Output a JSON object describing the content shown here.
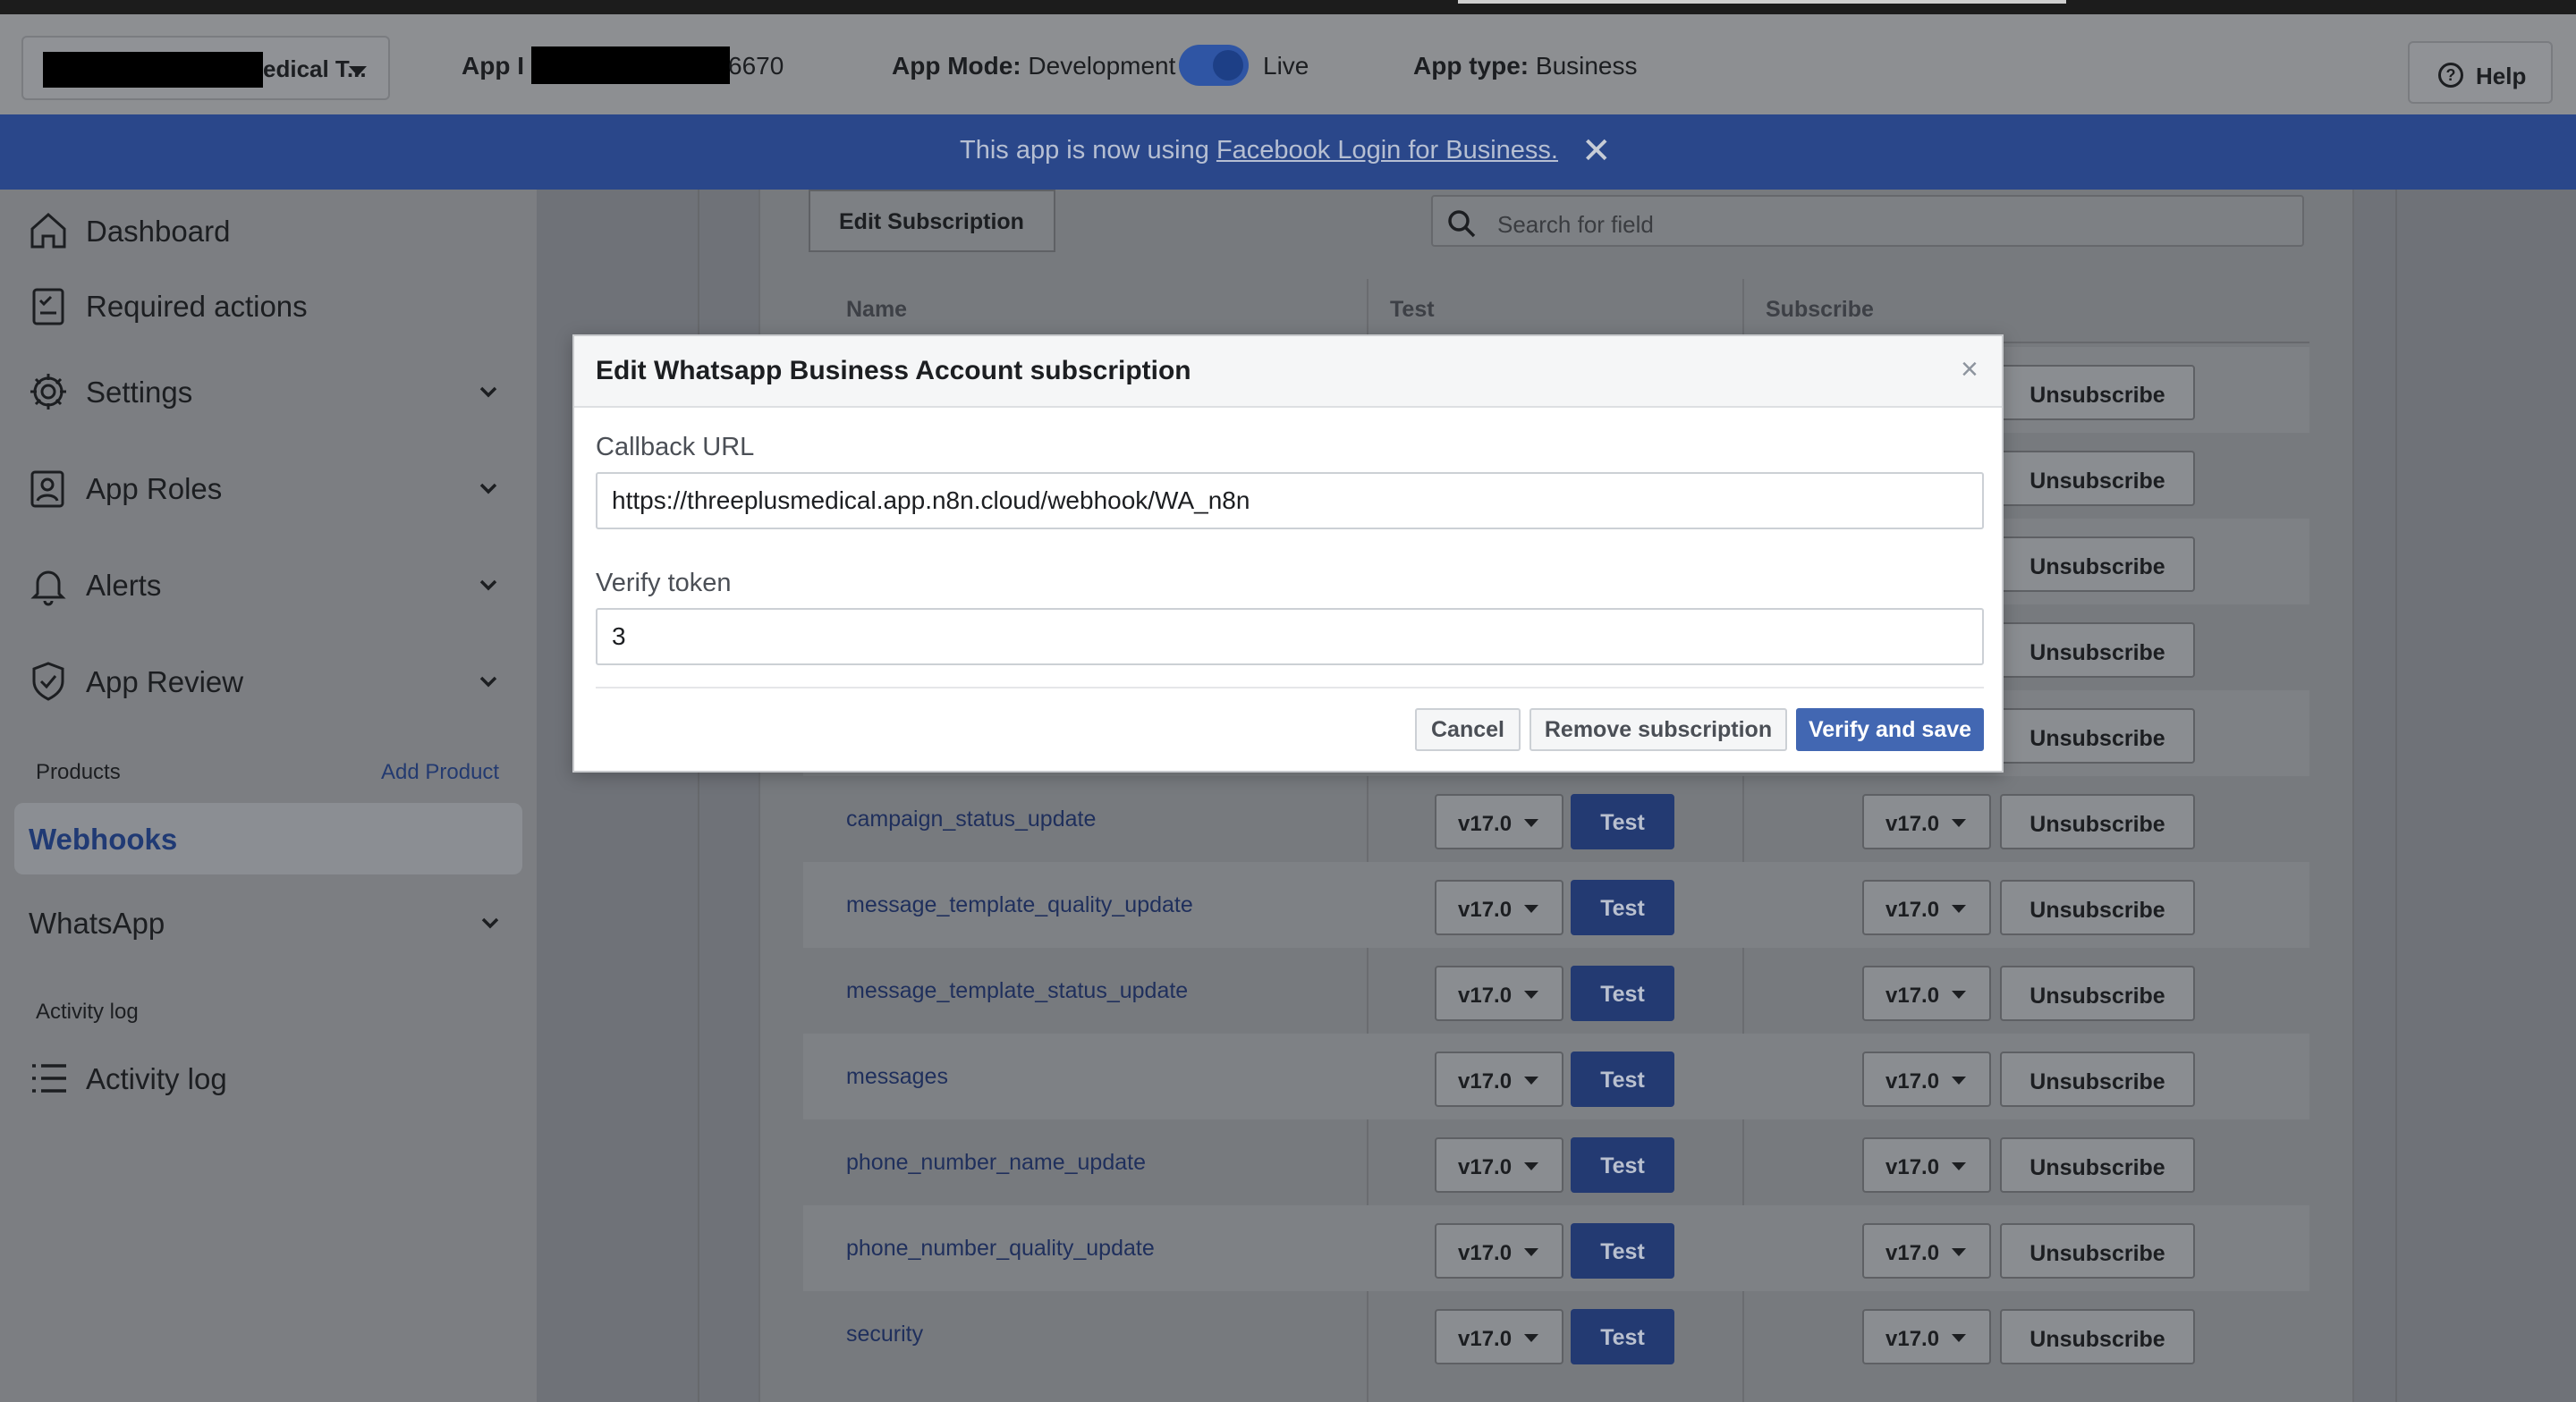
{
  "header": {
    "app_name_visible": "edical T...",
    "app_id_label": "App I",
    "app_id_tail": "6670",
    "app_mode_label": "App Mode:",
    "app_mode_value": "Development",
    "live_label": "Live",
    "app_type_label": "App type:",
    "app_type_value": "Business",
    "help_label": "Help"
  },
  "banner": {
    "text": "This app is now using ",
    "link": "Facebook Login for Business."
  },
  "sidebar": {
    "items": [
      {
        "label": "Dashboard",
        "icon": "home-icon"
      },
      {
        "label": "Required actions",
        "icon": "checklist-icon"
      },
      {
        "label": "Settings",
        "icon": "gear-icon"
      },
      {
        "label": "App Roles",
        "icon": "user-badge-icon"
      },
      {
        "label": "Alerts",
        "icon": "bell-icon"
      },
      {
        "label": "App Review",
        "icon": "shield-check-icon"
      }
    ],
    "products_label": "Products",
    "add_product_label": "Add Product",
    "webhooks_label": "Webhooks",
    "whatsapp_label": "WhatsApp",
    "activity_section_label": "Activity log",
    "activity_item_label": "Activity log"
  },
  "main": {
    "edit_subscription_label": "Edit Subscription",
    "search_placeholder": "Search for field",
    "columns": {
      "name": "Name",
      "test": "Test",
      "subscribe": "Subscribe"
    },
    "version": "v17.0",
    "test_label": "Test",
    "unsubscribe_label": "Unsubscribe",
    "rows": [
      "",
      "",
      "",
      "",
      "",
      "campaign_status_update",
      "message_template_quality_update",
      "message_template_status_update",
      "messages",
      "phone_number_name_update",
      "phone_number_quality_update",
      "security"
    ]
  },
  "modal": {
    "title": "Edit Whatsapp Business Account subscription",
    "close": "×",
    "callback_label": "Callback URL",
    "callback_value": "https://threeplusmedical.app.n8n.cloud/webhook/WA_n8n",
    "verify_label": "Verify token",
    "verify_value": "3",
    "cancel": "Cancel",
    "remove": "Remove subscription",
    "verify_save": "Verify and save"
  },
  "colors": {
    "banner": "#2a478a",
    "primary_button": "#4267b2",
    "test_button": "#233a72",
    "active_nav_text": "#203a74"
  }
}
